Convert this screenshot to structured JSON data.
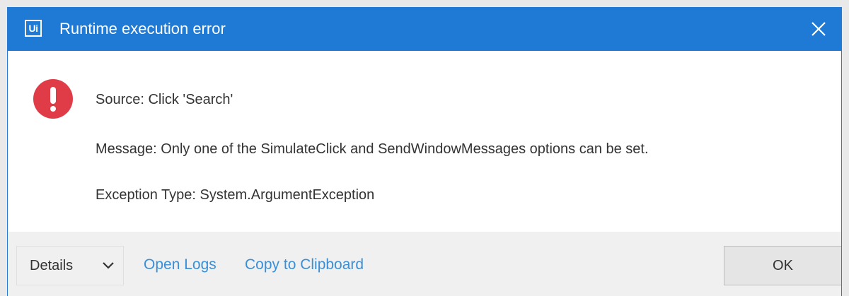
{
  "window": {
    "logo_text": "Ui",
    "title": "Runtime execution error"
  },
  "error": {
    "source": "Source: Click 'Search'",
    "message": "Message: Only one of the SimulateClick and SendWindowMessages options can be set.",
    "exception_type": "Exception Type: System.ArgumentException"
  },
  "footer": {
    "details_label": "Details",
    "open_logs_label": "Open Logs",
    "copy_clipboard_label": "Copy to Clipboard",
    "ok_label": "OK"
  },
  "colors": {
    "titlebar": "#1f7ad6",
    "error_icon": "#e03c48",
    "link": "#3a8fd6",
    "footer_bg": "#f0f0f0"
  },
  "icons": {
    "logo": "uipath-logo",
    "close": "close-icon",
    "error": "error-icon",
    "chevron": "chevron-down-icon"
  }
}
